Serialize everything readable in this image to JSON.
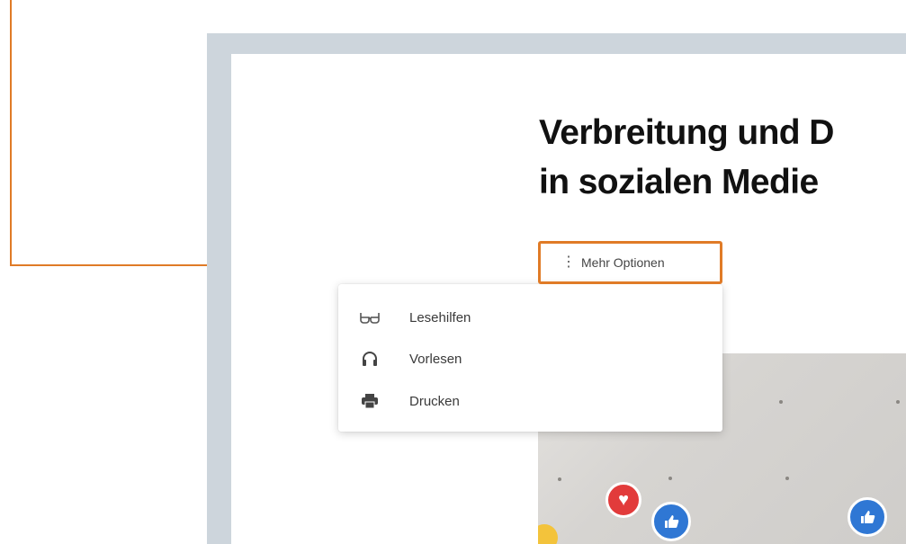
{
  "colors": {
    "callout": "#e07b27",
    "frame": "#cdd5dc",
    "heart": "#e23b3b",
    "like": "#2f77d4"
  },
  "headline": {
    "line1": "Verbreitung und D",
    "line2": "in sozialen Medie"
  },
  "more_options": {
    "icon": "kebab-vertical-icon",
    "label": "Mehr Optionen"
  },
  "menu": {
    "items": [
      {
        "icon": "glasses-icon",
        "label": "Lesehilfen"
      },
      {
        "icon": "headphones-icon",
        "label": "Vorlesen"
      },
      {
        "icon": "printer-icon",
        "label": "Drucken"
      }
    ]
  },
  "photo": {
    "icons": [
      "heart-reaction-icon",
      "thumbs-up-icon",
      "thumbs-up-icon"
    ]
  }
}
